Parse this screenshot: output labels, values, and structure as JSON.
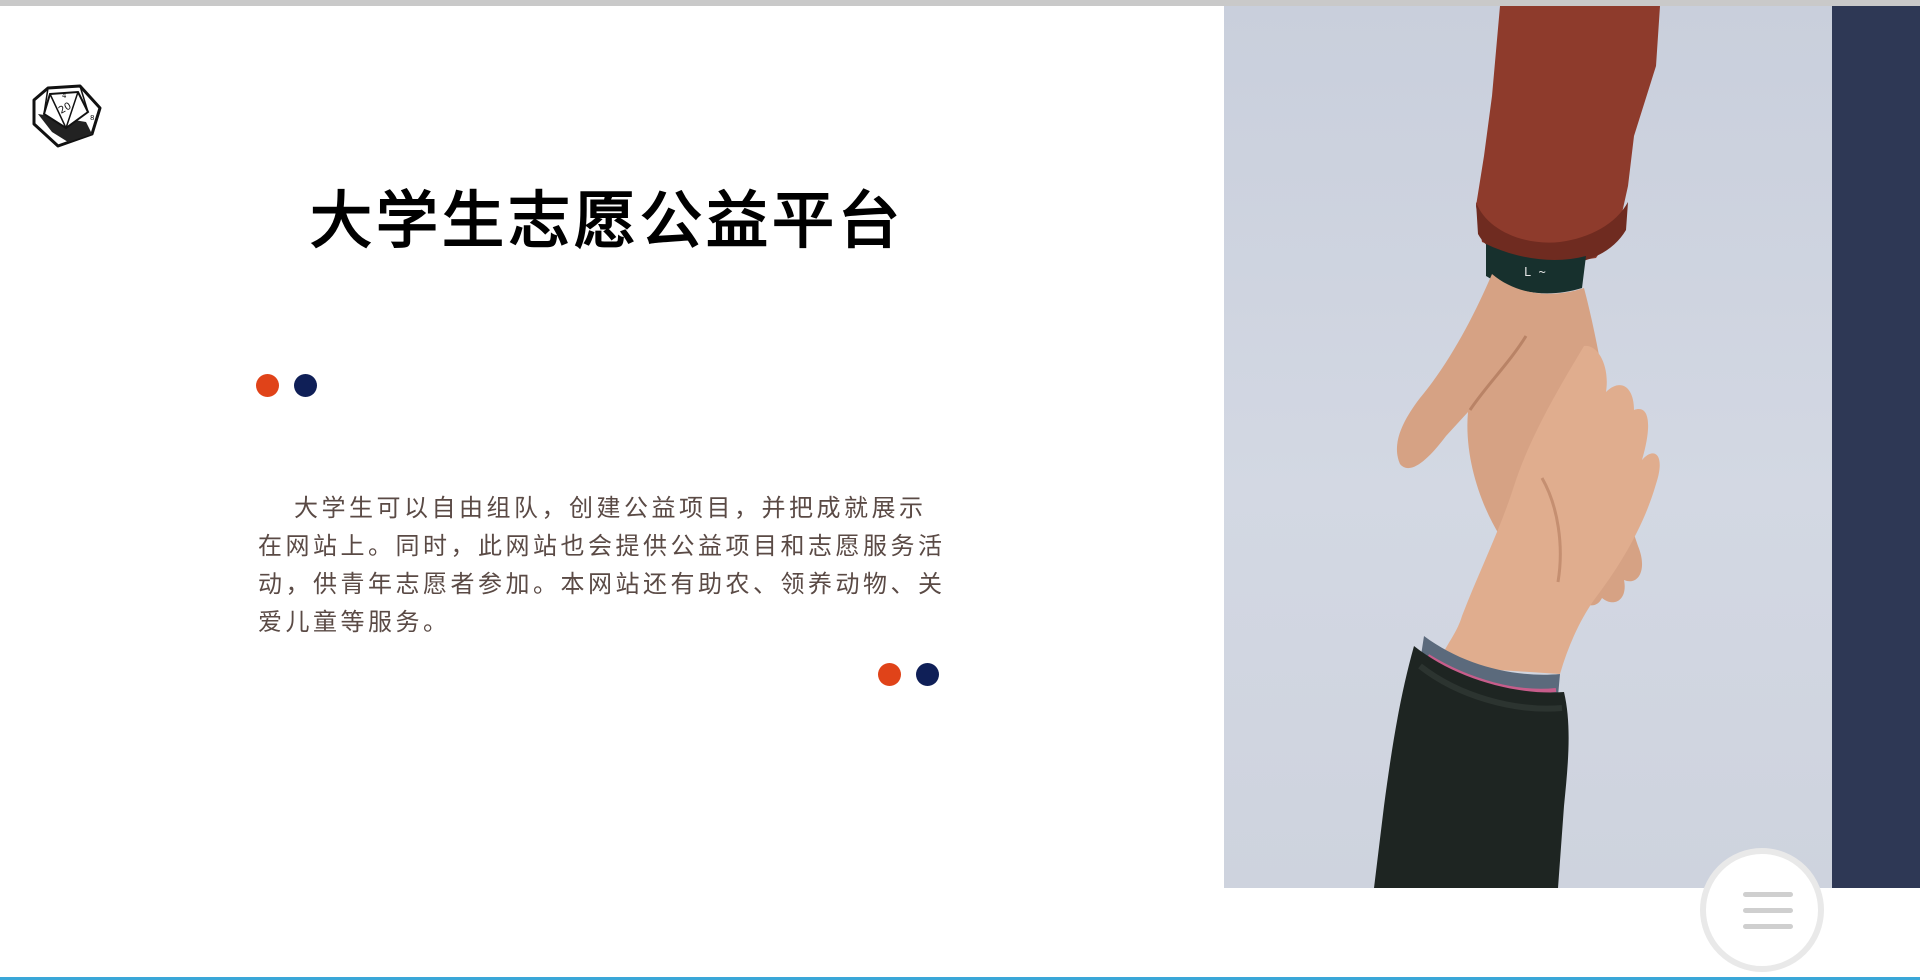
{
  "header": {
    "logo_icon": "d20-dice-icon"
  },
  "hero": {
    "title": "大学生志愿公益平台",
    "description": "大学生可以自由组队，创建公益项目，并把成就展示在网站上。同时，此网站也会提供公益项目和志愿服务活动，供青年志愿者参加。本网站还有助农、领养动物、关爱儿童等服务。"
  },
  "decor": {
    "dot_colors": [
      "#e04319",
      "#0f1f57"
    ]
  },
  "image": {
    "subject": "helping-hands-photo"
  },
  "menu": {
    "icon": "hamburger-menu-icon"
  }
}
